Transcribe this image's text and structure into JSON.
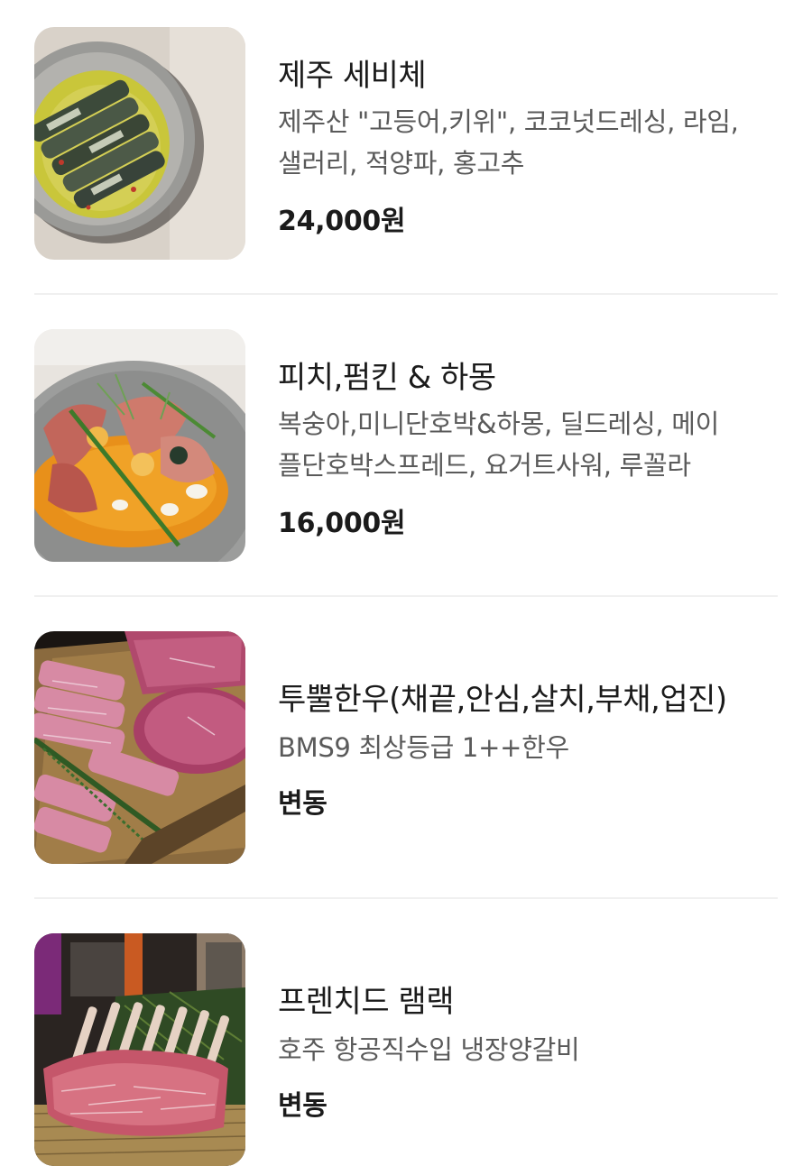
{
  "menu": {
    "items": [
      {
        "name": "제주 세비체",
        "description_lines": [
          "제주산 \"고등어,키위\", 코코넛드레싱, 라임,",
          "샐러리, 적양파, 홍고추"
        ],
        "price": "24,000원",
        "image": "ceviche-photo"
      },
      {
        "name": "피치,펌킨 & 하몽",
        "description_lines": [
          "복숭아,미니단호박&하몽, 딜드레싱, 메이",
          "플단호박스프레드, 요거트사워, 루꼴라"
        ],
        "price": "16,000원",
        "image": "peach-pumpkin-jamon-photo"
      },
      {
        "name": "투뿔한우(채끝,안심,살치,부채,업진)",
        "description_lines": [
          "BMS9 최상등급 1++한우"
        ],
        "price": "변동",
        "image": "hanwoo-beef-photo"
      },
      {
        "name": "프렌치드 램랙",
        "description_lines": [
          "호주 항공직수입 냉장양갈비"
        ],
        "price": "변동",
        "image": "lamb-rack-photo"
      }
    ]
  }
}
